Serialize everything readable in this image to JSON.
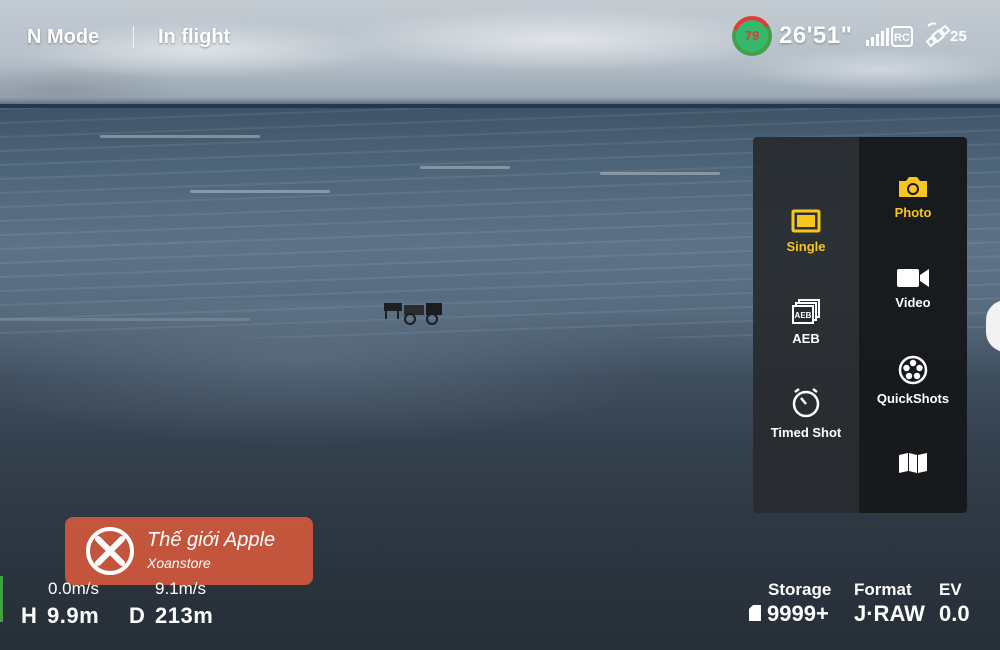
{
  "status_bar": {
    "mode": "N Mode",
    "flight_state": "In flight",
    "battery_percent": "79",
    "flight_time": "26'51\"",
    "rc_label": "RC",
    "gps_count": "25"
  },
  "capture_menu": {
    "modes": [
      {
        "label": "Photo",
        "icon": "camera-icon",
        "selected": true
      },
      {
        "label": "Video",
        "icon": "video-camera-icon",
        "selected": false
      },
      {
        "label": "QuickShots",
        "icon": "film-reel-icon",
        "selected": false
      },
      {
        "label": "",
        "icon": "panorama-map-icon",
        "selected": false
      }
    ],
    "photo_options": [
      {
        "label": "Single",
        "icon": "single-shot-icon",
        "selected": true
      },
      {
        "label": "AEB",
        "icon": "aeb-icon",
        "selected": false
      },
      {
        "label": "Timed Shot",
        "icon": "timer-icon",
        "selected": false
      }
    ]
  },
  "telemetry": {
    "vertical_speed": "0.0m/s",
    "horizontal_speed": "9.1m/s",
    "height_label": "H",
    "height_value": "9.9m",
    "distance_label": "D",
    "distance_value": "213m"
  },
  "camera_status": {
    "storage_label": "Storage",
    "storage_value": "9999+",
    "format_label": "Format",
    "format_value": "J·RAW",
    "ev_label": "EV",
    "ev_value": "0.0"
  },
  "watermark": {
    "title": "Thế giới Apple",
    "subtitle": "Xoanstore"
  },
  "colors": {
    "accent_selected": "#f6c61e",
    "battery_green": "#35b86b",
    "battery_red": "#e53935",
    "watermark_bg": "#d95a3c"
  }
}
